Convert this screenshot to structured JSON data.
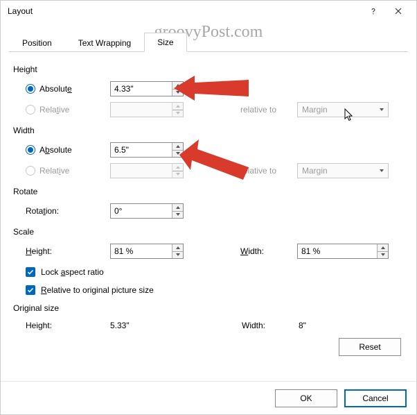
{
  "window": {
    "title": "Layout"
  },
  "watermark": "groovyPost.com",
  "tabs": {
    "position": "Position",
    "textwrap": "Text Wrapping",
    "size": "Size"
  },
  "height": {
    "label": "Height",
    "absolute_label_pre": "Absolut",
    "absolute_label_ul": "e",
    "absolute_value": "4.33\"",
    "relative_label_pre": "Rela",
    "relative_label_ul": "t",
    "relative_label_post": "ive",
    "relative_to_label": "relative to",
    "relative_to_value": "Margin"
  },
  "width": {
    "label": "Width",
    "absolute_label_pre": "A",
    "absolute_label_ul": "b",
    "absolute_label_post": "solute",
    "absolute_value": "6.5\"",
    "relative_label_pre": "Relat",
    "relative_label_ul": "i",
    "relative_label_post": "ve",
    "relative_to_label": "relative to",
    "relative_to_value": "Margin"
  },
  "rotate": {
    "label": "Rotate",
    "rotation_label_pre": "Rota",
    "rotation_label_ul": "t",
    "rotation_label_post": "ion:",
    "value": "0°"
  },
  "scale": {
    "label": "Scale",
    "height_label_ul": "H",
    "height_label_post": "eight:",
    "height_value": "81 %",
    "width_label_ul": "W",
    "width_label_post": "idth:",
    "width_value": "81 %",
    "lock_pre": "Lock ",
    "lock_ul": "a",
    "lock_post": "spect ratio",
    "rel_ul": "R",
    "rel_post": "elative to original picture size"
  },
  "original": {
    "label": "Original size",
    "height_label": "Height:",
    "height_value": "5.33\"",
    "width_label": "Width:",
    "width_value": "8\""
  },
  "buttons": {
    "reset_pre": "Re",
    "reset_ul": "s",
    "reset_post": "et",
    "ok": "OK",
    "cancel": "Cancel"
  }
}
